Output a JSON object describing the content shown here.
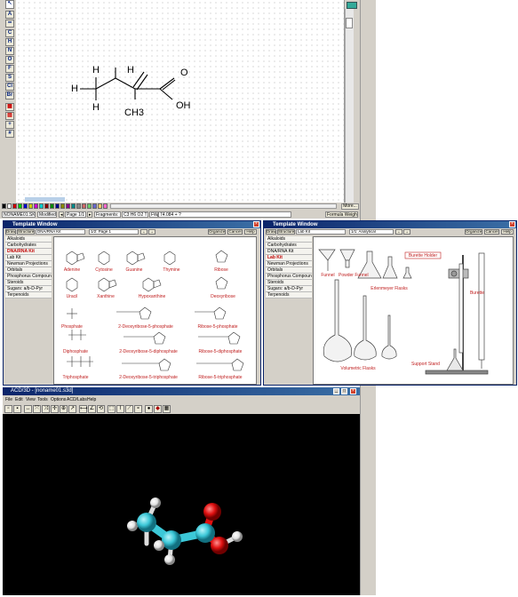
{
  "chemsketch": {
    "left_tools": [
      "C",
      "H",
      "N",
      "O",
      "F",
      "S",
      "Cl",
      "Br"
    ],
    "molecule_labels": {
      "h_top_left": "H",
      "h_top_mid": "H",
      "h_left": "H",
      "h_bottom": "H",
      "ch3": "CH3",
      "o_top": "O",
      "oh": "OH"
    },
    "status": {
      "file": "NONAME01.SK2",
      "modified": "Modified",
      "page": "Page 1/1",
      "fragments": "Fragments: 1",
      "formula": "C3 H6 O2 T2",
      "fw": "FW:",
      "fw_value": "74.084 + ?",
      "formula_weight_btn": "Formula Weight"
    },
    "more_btn": "More..."
  },
  "template_left": {
    "title": "Template Window",
    "toolbar": {
      "draw": "Draw",
      "structures": "Structures",
      "set": "DNA/RNA Kit",
      "page": "1/2: Page 1",
      "organizer": "Organizer",
      "cancel": "Cancel",
      "help": "Help"
    },
    "categories": [
      "Alkaloids",
      "Carbohydrates",
      "DNA/RNA Kit",
      "Lab Kit",
      "Newman Projections",
      "Orbitals",
      "Phosphorus Compounds",
      "Steroids",
      "Sugars: a/b-D-Pyr",
      "Terpenoids"
    ],
    "molecules": [
      "Adenine",
      "Cytosine",
      "Guanine",
      "Thymine",
      "Ribose",
      "Uracil",
      "Xanthine",
      "Hypoxanthine",
      "Deoxyribose",
      "Phosphate",
      "2-Deoxyribose-5-phosphate",
      "Ribose-5-phosphate",
      "Diphosphate",
      "2-Deoxyribose-5-diphosphate",
      "Ribose-5-diphosphate",
      "Triphosphate",
      "2-Deoxyribose-5-triphosphate",
      "Ribose-5-triphosphate"
    ]
  },
  "template_right": {
    "title": "Template Window",
    "toolbar": {
      "draw": "Draw",
      "structures": "Structures",
      "set": "Lab Kit",
      "page": "1/1: Analytical",
      "organizer": "Organizer",
      "cancel": "Cancel",
      "help": "Help"
    },
    "categories": [
      "Alkaloids",
      "Carbohydrates",
      "DNA/RNA Kit",
      "Lab Kit",
      "Newman Projections",
      "Orbitals",
      "Phosphorus Compounds",
      "Steroids",
      "Sugars: a/b-D-Pyr",
      "Terpenoids"
    ],
    "items": [
      "Funnel",
      "Powder Funnel",
      "Erlenmeyer Flasks",
      "Volumetric Flasks",
      "Burette Holder",
      "Burette",
      "Support Stand"
    ]
  },
  "viewer3d": {
    "title": "ACD/3D - [noname01.s3d]",
    "menu": [
      "File",
      "Edit",
      "View",
      "Tools",
      "Options",
      "ACD/Labs",
      "Help"
    ]
  },
  "colors": {
    "carbon": "#3cc8d8",
    "oxygen": "#e01010",
    "hydrogen": "#f0f0f0",
    "label_red": "#c02020"
  }
}
